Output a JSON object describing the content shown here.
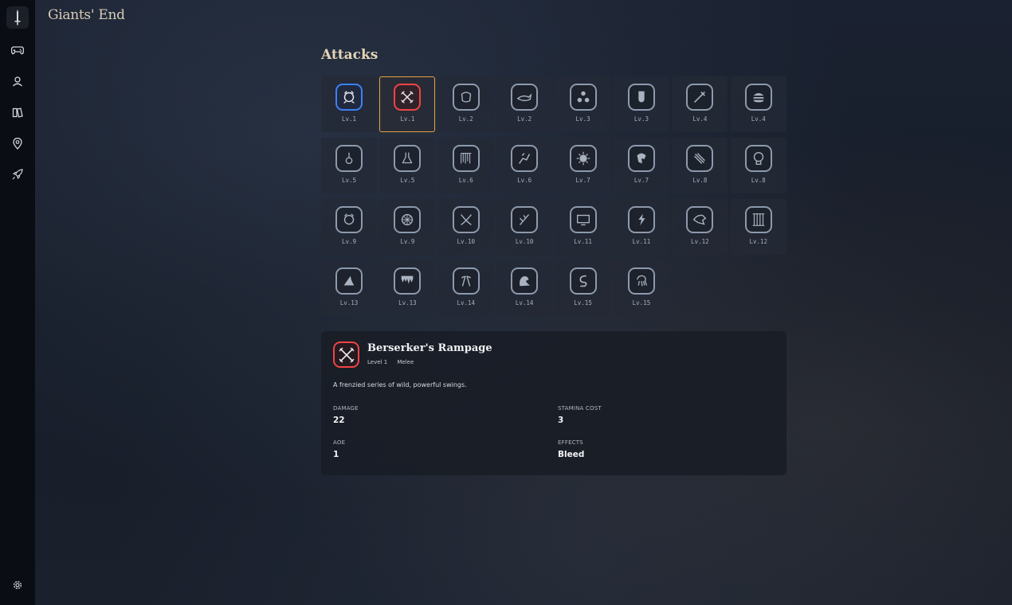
{
  "app": {
    "title": "Giants' End"
  },
  "sidebar": {
    "logo_icon": "sword-logo-icon",
    "items": [
      {
        "icon": "gamepad-icon"
      },
      {
        "icon": "user-icon"
      },
      {
        "icon": "book-icon"
      },
      {
        "icon": "map-pin-icon"
      },
      {
        "icon": "rocket-icon"
      }
    ],
    "settings_icon": "gear-icon"
  },
  "attacks": {
    "title": "Attacks",
    "items": [
      {
        "level": "Lv.1",
        "icon": "beast-icon",
        "highlight": "blue"
      },
      {
        "level": "Lv.1",
        "icon": "crossed-swords-icon",
        "highlight": "red",
        "selected": true
      },
      {
        "level": "Lv.2",
        "icon": "fist-icon"
      },
      {
        "level": "Lv.2",
        "icon": "whale-icon"
      },
      {
        "level": "Lv.3",
        "icon": "triple-orb-icon"
      },
      {
        "level": "Lv.3",
        "icon": "gauntlet-icon"
      },
      {
        "level": "Lv.4",
        "icon": "blade-strike-icon"
      },
      {
        "level": "Lv.4",
        "icon": "burger-icon"
      },
      {
        "level": "Lv.5",
        "icon": "pendulum-icon"
      },
      {
        "level": "Lv.5",
        "icon": "flask-icon"
      },
      {
        "level": "Lv.6",
        "icon": "spikes-icon"
      },
      {
        "level": "Lv.6",
        "icon": "rider-icon"
      },
      {
        "level": "Lv.7",
        "icon": "sunburst-icon"
      },
      {
        "level": "Lv.7",
        "icon": "dragon-head-icon"
      },
      {
        "level": "Lv.8",
        "icon": "claw-slash-icon"
      },
      {
        "level": "Lv.8",
        "icon": "brain-icon"
      },
      {
        "level": "Lv.9",
        "icon": "creature-icon"
      },
      {
        "level": "Lv.9",
        "icon": "wheel-icon"
      },
      {
        "level": "Lv.10",
        "icon": "tangled-vines-icon"
      },
      {
        "level": "Lv.10",
        "icon": "branch-icon"
      },
      {
        "level": "Lv.11",
        "icon": "monitor-icon"
      },
      {
        "level": "Lv.11",
        "icon": "lightning-fist-icon"
      },
      {
        "level": "Lv.12",
        "icon": "dinosaur-skull-icon"
      },
      {
        "level": "Lv.12",
        "icon": "cage-icon"
      },
      {
        "level": "Lv.13",
        "icon": "shark-fin-icon"
      },
      {
        "level": "Lv.13",
        "icon": "dripping-icon"
      },
      {
        "level": "Lv.14",
        "icon": "axes-icon"
      },
      {
        "level": "Lv.14",
        "icon": "wave-creature-icon"
      },
      {
        "level": "Lv.15",
        "icon": "serpent-icon"
      },
      {
        "level": "Lv.15",
        "icon": "kraken-icon"
      }
    ]
  },
  "detail": {
    "icon": "crossed-swords-icon",
    "name": "Berserker's Rampage",
    "level": "Level 1",
    "type": "Melee",
    "description": "A frenzied series of wild, powerful swings.",
    "damage_label": "DAMAGE",
    "damage": "22",
    "stamina_label": "STAMINA COST",
    "stamina": "3",
    "aoe_label": "AOE",
    "aoe": "1",
    "effects_label": "EFFECTS",
    "effects": "Bleed"
  },
  "colors": {
    "accent_orange": "#e9a23b",
    "highlight_blue": "#3b82f6",
    "highlight_red": "#ef4444"
  }
}
